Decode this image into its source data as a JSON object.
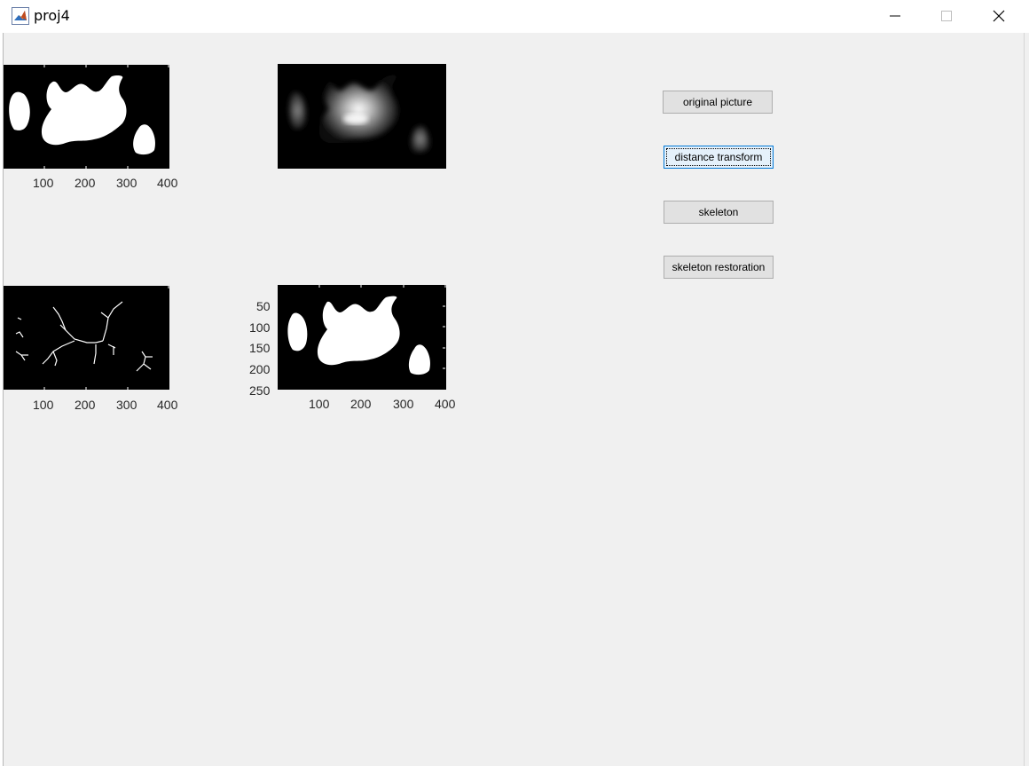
{
  "window": {
    "title": "proj4",
    "icon": "matlab-icon",
    "controls": [
      "minimize-icon",
      "maximize-icon",
      "close-icon"
    ]
  },
  "axes": {
    "top_left": {
      "x_ticks": [
        "100",
        "200",
        "300",
        "400"
      ],
      "y_ticks": []
    },
    "top_right": {
      "x_ticks": [],
      "y_ticks": []
    },
    "bottom_left": {
      "x_ticks": [
        "100",
        "200",
        "300",
        "400"
      ],
      "y_ticks": []
    },
    "bottom_right": {
      "x_ticks": [
        "100",
        "200",
        "300",
        "400"
      ],
      "y_ticks": [
        "50",
        "100",
        "150",
        "200",
        "250"
      ]
    }
  },
  "buttons": [
    {
      "label": "original picture",
      "focused": false
    },
    {
      "label": "distance transform",
      "focused": true
    },
    {
      "label": "skeleton",
      "focused": false
    },
    {
      "label": "skeleton restoration",
      "focused": false
    }
  ],
  "colors": {
    "axes_bg": "#000000",
    "figure_bg": "#f0f0f0",
    "focus_border": "#0078d7"
  }
}
